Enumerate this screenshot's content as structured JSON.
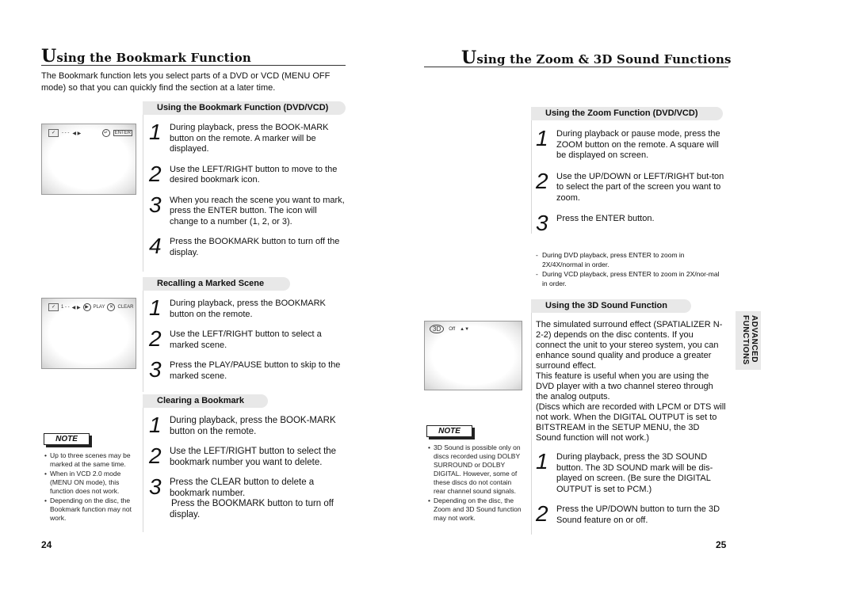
{
  "left_page": {
    "title_cap": "U",
    "title_rest": "sing the Bookmark Function",
    "intro": "The Bookmark function lets you select parts of a DVD or VCD (MENU OFF mode) so that you can quickly find the section at a later time.",
    "sections": [
      {
        "heading": "Using the Bookmark Function (DVD/VCD)",
        "steps": [
          {
            "num": "1",
            "text": "During playback, press the BOOK-MARK button on the remote. A marker will be displayed."
          },
          {
            "num": "2",
            "text": "Use the LEFT/RIGHT button to move to the desired bookmark icon."
          },
          {
            "num": "3",
            "text": "When you reach the scene you want to mark, press the ENTER button. The icon will change to a number (1, 2, or 3)."
          },
          {
            "num": "4",
            "text": "Press the BOOKMARK button to turn off the display."
          }
        ]
      },
      {
        "heading": "Recalling a Marked Scene",
        "steps": [
          {
            "num": "1",
            "text": "During playback, press the BOOKMARK button on the remote."
          },
          {
            "num": "2",
            "text": "Use the LEFT/RIGHT button to select a marked scene."
          },
          {
            "num": "3",
            "text": "Press the PLAY/PAUSE button to skip to the marked scene."
          }
        ]
      },
      {
        "heading": "Clearing a Bookmark",
        "steps": [
          {
            "num": "1",
            "text": "During playback, press the BOOK-MARK button on the remote."
          },
          {
            "num": "2",
            "text": "Use the LEFT/RIGHT button to select the bookmark number you want to delete."
          },
          {
            "num": "3",
            "text": "Press the CLEAR button to delete a bookmark number.",
            "extra": "Press the BOOKMARK button to turn off display."
          }
        ]
      }
    ],
    "screen1": {
      "dots": "- - -",
      "arrows": "◀ ▶",
      "enter_icon": "↵",
      "enter_label": "ENTER"
    },
    "screen2": {
      "marker": "1 - -",
      "arrows": "◀ ▶",
      "play_icon": "▶",
      "play_label": "PLAY",
      "clear_icon": "✕",
      "clear_label": "CLEAR"
    },
    "note": {
      "label": "NOTE",
      "items": [
        "Up to three scenes may be marked at the same time.",
        "When in VCD 2.0 mode (MENU ON mode), this function does not work.",
        "Depending on the disc, the Bookmark function may not work."
      ]
    },
    "page_number": "24"
  },
  "right_page": {
    "title_cap": "U",
    "title_rest": "sing the Zoom & 3D Sound Functions",
    "zoom_section": {
      "heading": "Using the Zoom Function (DVD/VCD)",
      "steps": [
        {
          "num": "1",
          "text": "During playback or pause mode, press the ZOOM button on the remote. A square will be displayed on screen."
        },
        {
          "num": "2",
          "text": "Use the UP/DOWN or LEFT/RIGHT but-ton to select the part of the screen you want to zoom."
        },
        {
          "num": "3",
          "text": "Press the ENTER button."
        }
      ],
      "notes": [
        "During DVD playback, press ENTER to zoom in 2X/4X/normal in order.",
        "During VCD playback, press ENTER to zoom in 2X/nor-mal in order."
      ]
    },
    "sound_section": {
      "heading": "Using the 3D Sound Function",
      "paragraphs": [
        "The simulated surround effect (SPATIALIZER N-2-2) depends on the disc contents. If you connect the unit to your stereo system, you can enhance sound quality and produce a greater surround effect.",
        "This feature is useful when you are using the DVD player with a two channel stereo through the analog outputs.",
        "(Discs which are recorded with LPCM or DTS will not work. When the DIGITAL OUTPUT is set to BITSTREAM in the SETUP MENU, the 3D Sound function will not work.)"
      ],
      "steps": [
        {
          "num": "1",
          "text": "During playback, press the 3D SOUND button. The 3D SOUND mark will be dis-played on screen. (Be sure the DIGITAL OUTPUT is set to PCM.)"
        },
        {
          "num": "2",
          "text": "Press the UP/DOWN button to turn the 3D Sound feature on or off."
        }
      ]
    },
    "screen3": {
      "badge": "3D",
      "state": "Off",
      "arrows": "▲▼"
    },
    "note": {
      "label": "NOTE",
      "items": [
        "3D Sound is possible only on discs recorded using DOLBY SURROUND or DOLBY DIGITAL. However, some of these discs do not contain rear channel sound signals.",
        "Depending on the disc, the Zoom and 3D Sound function may not work."
      ]
    },
    "side_tab": [
      "ADVANCED",
      "FUNCTIONS"
    ],
    "page_number": "25"
  }
}
